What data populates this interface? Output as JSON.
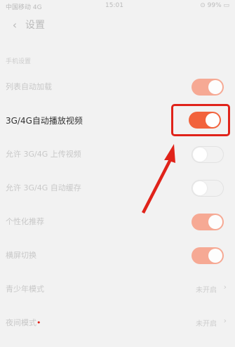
{
  "status_bar": {
    "carrier": "中国移动 4G",
    "time": "15:01",
    "battery": "⊙ 99% ▭"
  },
  "header": {
    "title": "设置"
  },
  "section_label": "手机设置",
  "rows": [
    {
      "label": "列表自动加载",
      "control": "toggle",
      "state": "on"
    },
    {
      "label": "3G/4G自动播放视频",
      "control": "toggle",
      "state": "on"
    },
    {
      "label": "允许 3G/4G 上传视频",
      "control": "toggle",
      "state": "off"
    },
    {
      "label": "允许 3G/4G 自动缓存",
      "control": "toggle",
      "state": "off"
    },
    {
      "label": "个性化推荐",
      "control": "toggle",
      "state": "on"
    },
    {
      "label": "横屏切换",
      "control": "toggle",
      "state": "on"
    },
    {
      "label": "青少年模式",
      "control": "select",
      "value": "未开启"
    },
    {
      "label": "夜间模式",
      "control": "select",
      "value": "未开启"
    }
  ],
  "colors": {
    "accent": "#f2623c",
    "highlight": "#e0231a"
  }
}
